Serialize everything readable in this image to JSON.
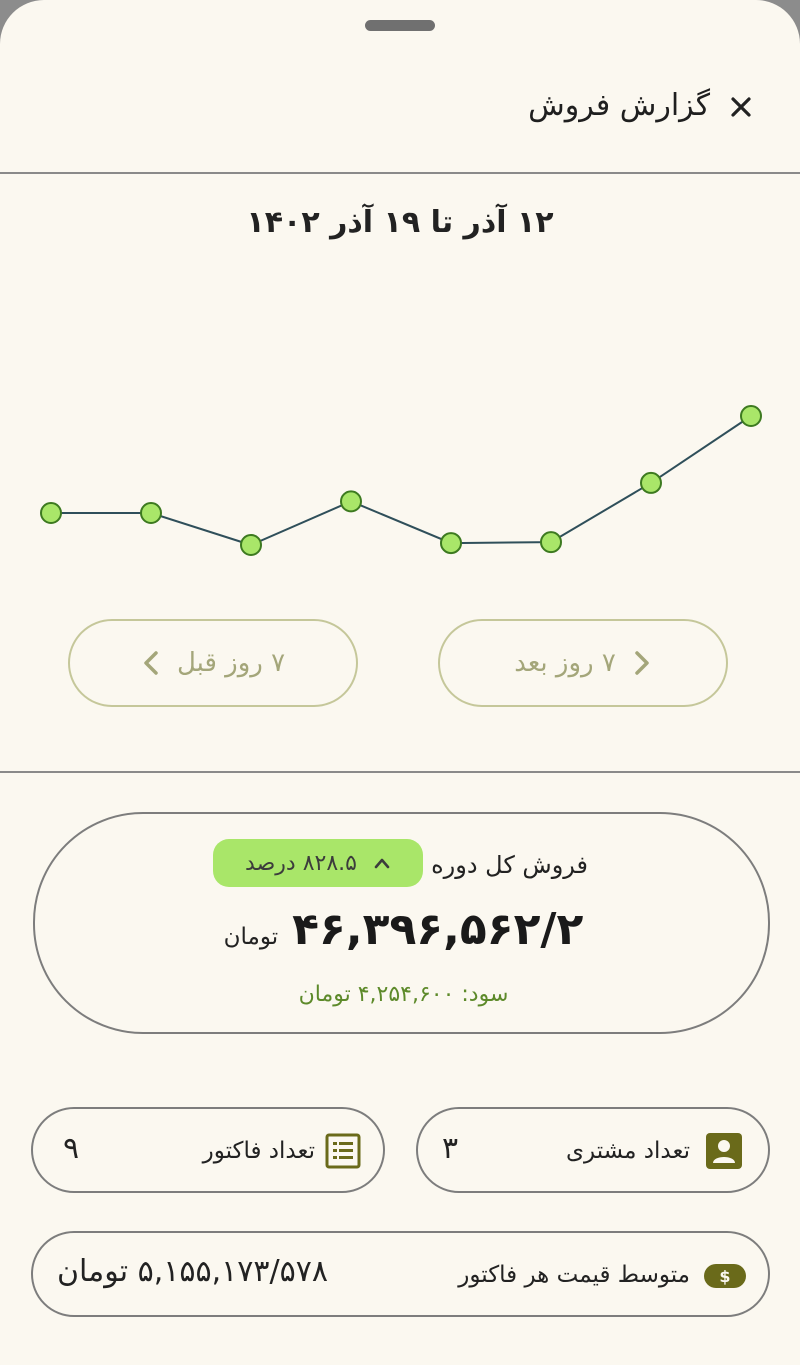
{
  "header": {
    "title": "گزارش فروش",
    "close_icon": "close-icon"
  },
  "period": {
    "range": "۱۲ آذر تا ۱۹ آذر ۱۴۰۲"
  },
  "nav": {
    "next_label": "۷ روز بعد",
    "prev_label": "۷ روز قبل"
  },
  "chart_data": {
    "type": "line",
    "series": [
      {
        "values": [
          0.0,
          0.0,
          -0.33,
          0.12,
          -0.31,
          -0.3,
          0.31,
          1.0
        ]
      }
    ],
    "grid": false,
    "point_color": "#a9e669",
    "line_color": "#2f4f5a"
  },
  "total": {
    "label": "فروش کل دوره",
    "change_badge": "۸۲۸.۵ درصد",
    "change_direction": "up",
    "amount": "۴۶,۳۹۶,۵۶۲/۲",
    "unit": "تومان",
    "profit": "سود: ۴,۲۵۴,۶۰۰ تومان"
  },
  "stats": {
    "invoice_count": {
      "label": "تعداد فاکتور",
      "value": "۹",
      "icon": "invoice-list-icon"
    },
    "customer_count": {
      "label": "تعداد مشتری",
      "value": "۳",
      "icon": "person-icon"
    },
    "avg_invoice": {
      "label": "متوسط قیمت هر فاکتور",
      "value": "۵,۱۵۵,۱۷۳/۵۷۸ تومان",
      "icon": "dollar-icon"
    }
  },
  "colors": {
    "accent_green": "#a9e669",
    "profit_green": "#5d8a2a",
    "icon_olive": "#6a6a1a",
    "button_border": "#c5c79a"
  }
}
